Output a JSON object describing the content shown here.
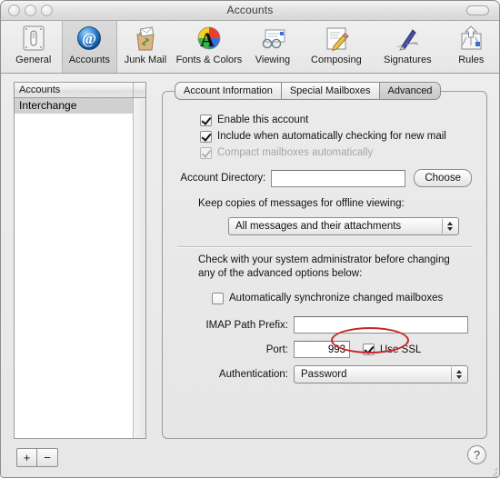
{
  "window": {
    "title": "Accounts",
    "traffic_lights": [
      "close",
      "minimize",
      "zoom"
    ],
    "toolbar_toggle": "toolbar-toggle"
  },
  "toolbar": {
    "items": [
      {
        "label": "General",
        "icon": "general-icon",
        "selected": false
      },
      {
        "label": "Accounts",
        "icon": "accounts-at-icon",
        "selected": true
      },
      {
        "label": "Junk Mail",
        "icon": "junk-mail-icon",
        "selected": false
      },
      {
        "label": "Fonts & Colors",
        "icon": "fonts-colors-icon",
        "selected": false
      },
      {
        "label": "Viewing",
        "icon": "viewing-icon",
        "selected": false
      },
      {
        "label": "Composing",
        "icon": "composing-icon",
        "selected": false
      },
      {
        "label": "Signatures",
        "icon": "signatures-icon",
        "selected": false
      },
      {
        "label": "Rules",
        "icon": "rules-icon",
        "selected": false
      }
    ]
  },
  "sidebar": {
    "column_header": "Accounts",
    "rows": [
      {
        "label": "Interchange",
        "selected": true
      }
    ],
    "add_button": "+",
    "remove_button": "−"
  },
  "tabs": [
    {
      "label": "Account Information",
      "active": false
    },
    {
      "label": "Special Mailboxes",
      "active": false
    },
    {
      "label": "Advanced",
      "active": true
    }
  ],
  "advanced": {
    "checkbox_enable_account": {
      "label": "Enable this account",
      "checked": true,
      "disabled": false
    },
    "checkbox_include_check": {
      "label": "Include when automatically checking for new mail",
      "checked": true,
      "disabled": false
    },
    "checkbox_compact": {
      "label": "Compact mailboxes automatically",
      "checked": true,
      "disabled": true
    },
    "account_directory": {
      "label": "Account Directory:",
      "value": "",
      "placeholder": "",
      "button": "Choose"
    },
    "offline_copies": {
      "label": "Keep copies of messages for offline viewing:",
      "selected": "All messages and their attachments"
    },
    "admin_warning": "Check with your system administrator before changing any of the advanced options below:",
    "checkbox_auto_sync": {
      "label": "Automatically synchronize changed mailboxes",
      "checked": false,
      "disabled": false
    },
    "imap_path_prefix": {
      "label": "IMAP Path Prefix:",
      "value": "",
      "placeholder": ""
    },
    "port": {
      "label": "Port:",
      "value": "993"
    },
    "use_ssl": {
      "label": "Use SSL",
      "checked": true
    },
    "authentication": {
      "label": "Authentication:",
      "selected": "Password"
    }
  },
  "annotation": {
    "shape": "ellipse",
    "color": "#c7252b",
    "targets": "use-ssl-checkbox"
  },
  "help_button": "?"
}
